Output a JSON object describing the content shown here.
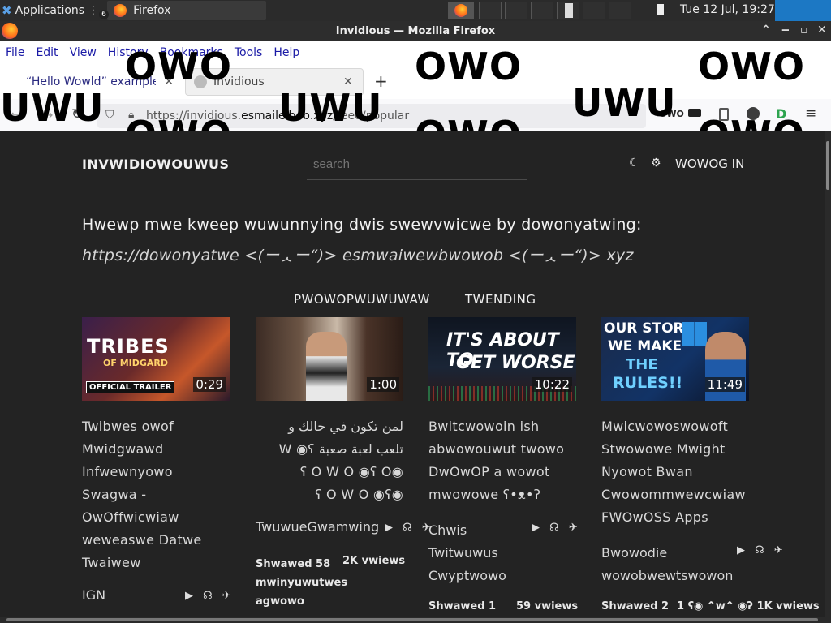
{
  "taskbar": {
    "apps_label": "Applications",
    "firefox_label": "Firefox",
    "firefox_count": "6",
    "clock": "Tue 12 Jul, 19:27"
  },
  "window": {
    "title": "Invidious — Mozilla Firefox"
  },
  "menu": [
    "File",
    "Edit",
    "View",
    "History",
    "Bookmarks",
    "Tools",
    "Help"
  ],
  "tabs": [
    {
      "label": "“Hello Wowld” example |"
    },
    {
      "label": "Invidious"
    }
  ],
  "url": {
    "prefix": "https://invidious.",
    "domain": "esmailelbob.xyz",
    "path": "/feed/popular"
  },
  "overlay_text": {
    "owo": "OWO",
    "uwu": "UWU"
  },
  "site": {
    "brand": "INVWIDIOWOUWUS",
    "search_placeholder": "search",
    "login": "WOWOG IN",
    "notice_line1": "Hwewp mwe kweep wuwunnying dwis swewvwicwe by dowonyatwing:",
    "notice_line2": "https://dowonyatwe <(ーᆺー“)> esmwaiwewbwowob <(ーᆺー“)> xyz",
    "feed_tabs": [
      "PWOWOPWUWUWAW",
      "TWENDING"
    ]
  },
  "videos": [
    {
      "thumb_title": "TRIBES",
      "thumb_sub": "OF MIDGARD",
      "thumb_badge": "OFFICIAL TRAILER",
      "duration": "0:29",
      "title_lines": [
        "Twibwes owof",
        "Mwidgwawd",
        "Infwewnyowo",
        "Swagwa -",
        "OwOffwicwiaw",
        "weweaswe Datwe",
        "Twaiwew"
      ],
      "author": "IGN",
      "shared": "",
      "views": ""
    },
    {
      "duration": "1:00",
      "title_lines": [
        "لمن تكون في حالك و",
        "تلعب لعبة صعبة W ◉ʕ",
        "◉ʕ O W O ◉ʕ O",
        "◉ʕ O W O ◉ʕ"
      ],
      "author": "TwuwueGwamwing",
      "shared": "Shwawed 58 mwinyuwutwes agwowo",
      "views": "2K vwiews"
    },
    {
      "thumb_text1": "IT'S ABOUT TO",
      "thumb_text2": "GET WORSE",
      "duration": "10:22",
      "title_lines": [
        "Bwitcwowoin ish",
        "abwowouwut twowo",
        "DwOwOP a wowot",
        "mwowowe ʕ•ᴥ•ʔ"
      ],
      "author_lines": [
        "Chwis",
        "Twitwuwus",
        "Cwyptwowo"
      ],
      "shared": "Shwawed 1",
      "views": "59 vwiews"
    },
    {
      "thumb_text1": "OUR STORE",
      "thumb_text2": "WE MAKE",
      "thumb_text3": "THE",
      "thumb_text4": "RULES!!",
      "duration": "11:49",
      "title_lines": [
        "Mwicwowoswowoft",
        "Stwowowe Mwight",
        "Nyowot Bwan",
        "Cwowommwewcwiaw",
        "FWOwOSS Apps"
      ],
      "author_lines": [
        "Bwowodie",
        "wowobwewtswowon"
      ],
      "shared": "Shwawed 2",
      "views": "1 ʕ◉ ^w^ ◉ʔ 1K vwiews"
    }
  ],
  "video_action_icons": "▶ ☊ ✈"
}
